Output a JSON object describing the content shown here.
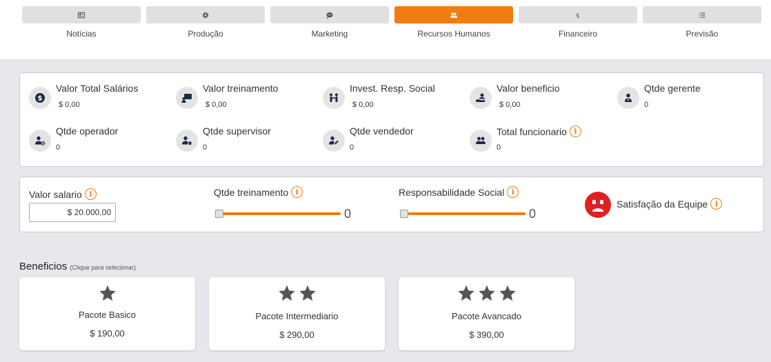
{
  "nav": {
    "tabs": [
      {
        "label": "Notícias",
        "icon": "newspaper-icon"
      },
      {
        "label": "Produção",
        "icon": "gear-icon"
      },
      {
        "label": "Marketing",
        "icon": "chat-icon"
      },
      {
        "label": "Recursos Humanos",
        "icon": "users-icon"
      },
      {
        "label": "Financeiro",
        "icon": "dollar-icon"
      },
      {
        "label": "Previsão",
        "icon": "list-icon"
      }
    ],
    "active": "Recursos Humanos",
    "accent_color": "#ef7d10"
  },
  "kpis": [
    {
      "title": "Valor Total Salários",
      "value": "$ 0,00",
      "icon": "dollar-circle-icon"
    },
    {
      "title": "Valor treinamento",
      "value": "$ 0,00",
      "icon": "chalkboard-icon"
    },
    {
      "title": "Invest. Resp. Social",
      "value": "$ 0,00",
      "icon": "people-handshake-icon"
    },
    {
      "title": "Valor beneficio",
      "value": "$ 0,00",
      "icon": "hand-user-icon"
    },
    {
      "title": "Qtde gerente",
      "value": "0",
      "icon": "manager-icon"
    },
    {
      "title": "Qtde operador",
      "value": "0",
      "icon": "user-gear-icon"
    },
    {
      "title": "Qtde supervisor",
      "value": "0",
      "icon": "user-shield-icon"
    },
    {
      "title": "Qtde vendedor",
      "value": "0",
      "icon": "user-edit-icon"
    },
    {
      "title": "Total funcionario",
      "value": "0",
      "icon": "users-icon"
    }
  ],
  "controls": {
    "salary_label": "Valor salario",
    "salary_value": "$ 20.000,00",
    "training_label": "Qtde treinamento",
    "training_value": "0",
    "social_label": "Responsabilidade Social",
    "social_value": "0",
    "satisfaction_label": "Satisfação da Equipe",
    "satisfaction_color": "#e02020"
  },
  "benefits": {
    "title": "Beneficios",
    "hint": "(Clique para selecionar)",
    "packages": [
      {
        "name": "Pacote Basico",
        "price": "$ 190,00",
        "stars": 1
      },
      {
        "name": "Pacote Intermediario",
        "price": "$ 290,00",
        "stars": 2
      },
      {
        "name": "Pacote Avancado",
        "price": "$ 390,00",
        "stars": 3
      }
    ]
  }
}
